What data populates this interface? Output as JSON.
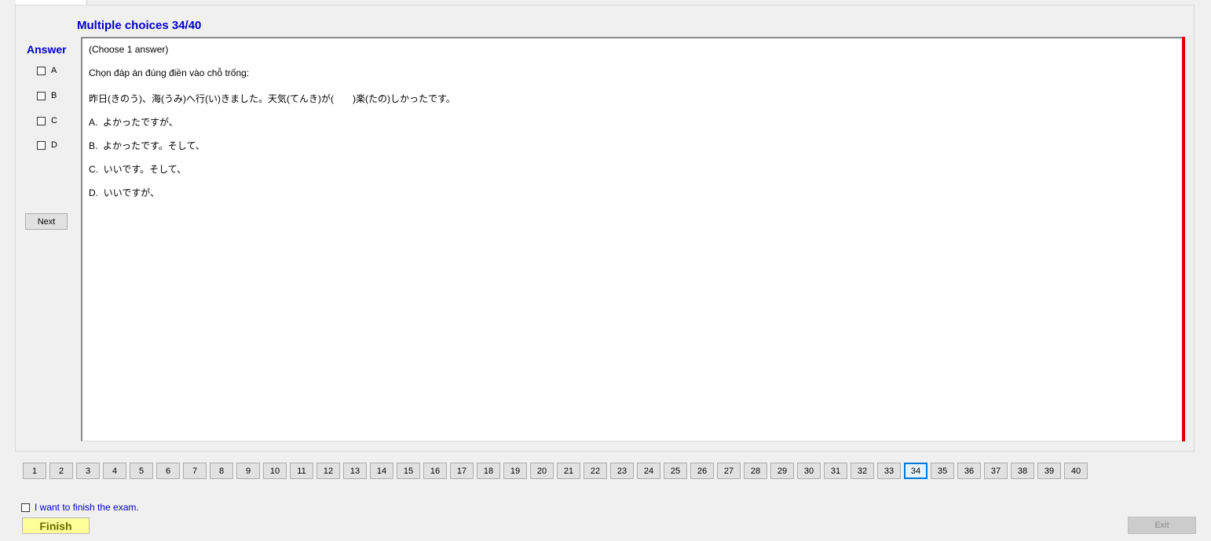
{
  "header": {
    "title": "Multiple choices 34/40"
  },
  "answer": {
    "heading": "Answer",
    "options": [
      "A",
      "B",
      "C",
      "D"
    ],
    "next_label": "Next"
  },
  "question": {
    "lines": [
      "(Choose 1 answer)",
      "Chọn đáp án đúng điền vào chỗ trống:",
      "昨日(きのう)、海(うみ)へ行(い)きました。天気(てんき)が(　　)楽(たの)しかったです。",
      "A.  よかったですが、",
      "B.  よかったです。そして、",
      "C.  いいです。そして、",
      "D.  いいですが、"
    ]
  },
  "navigation": {
    "pages": [
      "1",
      "2",
      "3",
      "4",
      "5",
      "6",
      "7",
      "8",
      "9",
      "10",
      "11",
      "12",
      "13",
      "14",
      "15",
      "16",
      "17",
      "18",
      "19",
      "20",
      "21",
      "22",
      "23",
      "24",
      "25",
      "26",
      "27",
      "28",
      "29",
      "30",
      "31",
      "32",
      "33",
      "34",
      "35",
      "36",
      "37",
      "38",
      "39",
      "40"
    ],
    "current": "34"
  },
  "footer": {
    "finish_checkbox_label": "I want to finish the exam.",
    "finish_label": "Finish",
    "exit_label": "Exit"
  },
  "colors": {
    "title": "#0000cc",
    "accent_bar": "#e00000",
    "finish_bg": "#ffff99",
    "active_page_border": "#0078d7"
  }
}
